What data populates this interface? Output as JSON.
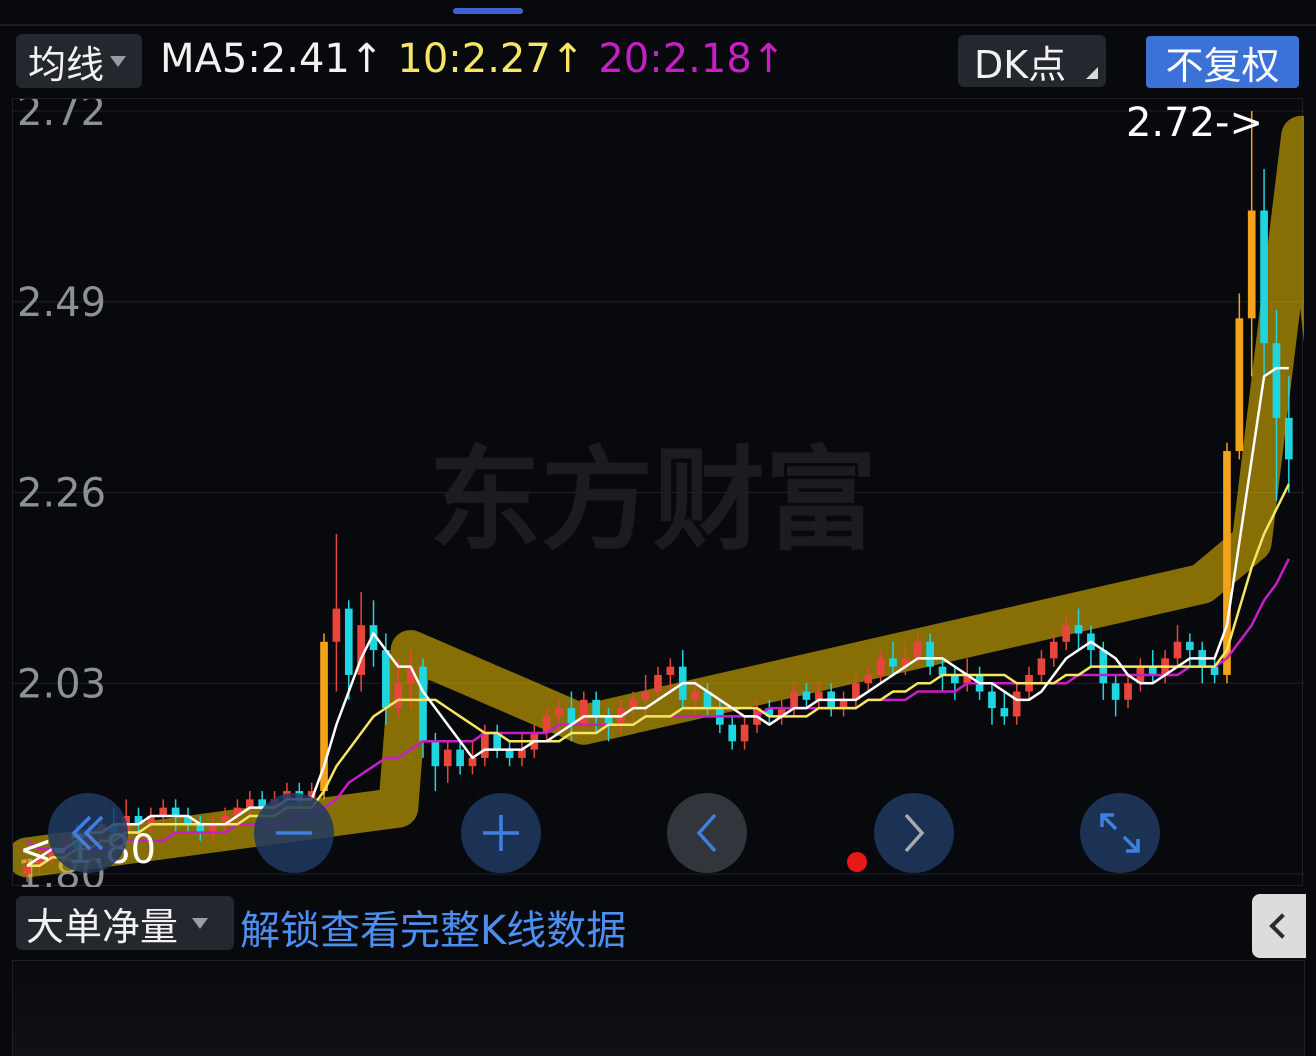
{
  "header": {
    "ma_dropdown_label": "均线",
    "ma5_text": "MA5:2.41↑",
    "ma10_text": "10:2.27↑",
    "ma20_text": "20:2.18↑",
    "dk_label": "DK点",
    "fq_label": "不复权"
  },
  "colors": {
    "up": "#e8453c",
    "down": "#1fd6e0",
    "ma5": "#ffffff",
    "ma10": "#f5e663",
    "ma20": "#c81ec8",
    "accent": "#3c72d8",
    "highlight": "#f2c300",
    "orange_bar": "#f5a21b"
  },
  "chart_data": {
    "type": "candlestick",
    "y_ticks": [
      "2.72",
      "2.49",
      "2.26",
      "2.03",
      "1.80"
    ],
    "ylim": [
      1.8,
      2.72
    ],
    "max_marker": "2.72->",
    "min_marker": "<-1.80",
    "watermark": "东方财富",
    "candles": [
      [
        1.8,
        1.81,
        1.79,
        1.82
      ],
      [
        1.81,
        1.82,
        1.8,
        1.83
      ],
      [
        1.82,
        1.83,
        1.81,
        1.84
      ],
      [
        1.83,
        1.84,
        1.82,
        1.85
      ],
      [
        1.84,
        1.83,
        1.82,
        1.86
      ],
      [
        1.83,
        1.85,
        1.82,
        1.86
      ],
      [
        1.85,
        1.86,
        1.84,
        1.87
      ],
      [
        1.86,
        1.85,
        1.84,
        1.88
      ],
      [
        1.85,
        1.87,
        1.84,
        1.89
      ],
      [
        1.87,
        1.86,
        1.85,
        1.88
      ],
      [
        1.86,
        1.87,
        1.85,
        1.88
      ],
      [
        1.87,
        1.88,
        1.86,
        1.89
      ],
      [
        1.88,
        1.87,
        1.85,
        1.89
      ],
      [
        1.87,
        1.86,
        1.85,
        1.88
      ],
      [
        1.86,
        1.85,
        1.84,
        1.87
      ],
      [
        1.85,
        1.86,
        1.84,
        1.87
      ],
      [
        1.86,
        1.87,
        1.85,
        1.88
      ],
      [
        1.87,
        1.88,
        1.86,
        1.89
      ],
      [
        1.88,
        1.89,
        1.87,
        1.9
      ],
      [
        1.89,
        1.88,
        1.87,
        1.9
      ],
      [
        1.88,
        1.89,
        1.87,
        1.9
      ],
      [
        1.89,
        1.9,
        1.88,
        1.91
      ],
      [
        1.9,
        1.89,
        1.88,
        1.91
      ],
      [
        1.89,
        1.9,
        1.88,
        1.91
      ],
      [
        1.9,
        2.08,
        1.89,
        2.09
      ],
      [
        2.08,
        2.12,
        2.02,
        2.21
      ],
      [
        2.12,
        2.04,
        2.01,
        2.13
      ],
      [
        2.04,
        2.1,
        2.02,
        2.14
      ],
      [
        2.1,
        2.07,
        2.05,
        2.13
      ],
      [
        2.07,
        2.0,
        1.98,
        2.09
      ],
      [
        2.0,
        2.03,
        1.99,
        2.06
      ],
      [
        2.03,
        2.05,
        2.0,
        2.07
      ],
      [
        2.05,
        1.96,
        1.94,
        2.06
      ],
      [
        1.96,
        1.93,
        1.9,
        1.97
      ],
      [
        1.93,
        1.95,
        1.91,
        1.96
      ],
      [
        1.95,
        1.93,
        1.92,
        1.96
      ],
      [
        1.93,
        1.94,
        1.92,
        1.96
      ],
      [
        1.94,
        1.97,
        1.93,
        1.98
      ],
      [
        1.97,
        1.95,
        1.94,
        1.98
      ],
      [
        1.95,
        1.94,
        1.93,
        1.96
      ],
      [
        1.94,
        1.95,
        1.93,
        1.97
      ],
      [
        1.95,
        1.97,
        1.94,
        1.98
      ],
      [
        1.97,
        1.99,
        1.96,
        2.0
      ],
      [
        1.99,
        2.0,
        1.97,
        2.01
      ],
      [
        2.0,
        1.98,
        1.96,
        2.02
      ],
      [
        1.98,
        2.01,
        1.97,
        2.02
      ],
      [
        2.01,
        1.99,
        1.97,
        2.02
      ],
      [
        1.99,
        1.98,
        1.96,
        2.0
      ],
      [
        1.98,
        2.0,
        1.97,
        2.01
      ],
      [
        2.0,
        2.01,
        1.98,
        2.02
      ],
      [
        2.01,
        2.02,
        1.99,
        2.04
      ],
      [
        2.02,
        2.04,
        2.01,
        2.05
      ],
      [
        2.04,
        2.05,
        2.02,
        2.06
      ],
      [
        2.05,
        2.01,
        2.0,
        2.07
      ],
      [
        2.01,
        2.02,
        1.99,
        2.03
      ],
      [
        2.02,
        2.0,
        1.99,
        2.03
      ],
      [
        2.0,
        1.98,
        1.97,
        2.01
      ],
      [
        1.98,
        1.96,
        1.95,
        1.99
      ],
      [
        1.96,
        1.98,
        1.95,
        1.99
      ],
      [
        1.98,
        2.0,
        1.97,
        2.01
      ],
      [
        2.0,
        1.99,
        1.98,
        2.01
      ],
      [
        1.99,
        2.0,
        1.98,
        2.01
      ],
      [
        2.0,
        2.02,
        1.99,
        2.03
      ],
      [
        2.02,
        2.01,
        2.0,
        2.03
      ],
      [
        2.01,
        2.02,
        2.0,
        2.03
      ],
      [
        2.02,
        2.0,
        1.99,
        2.03
      ],
      [
        2.0,
        2.01,
        1.99,
        2.02
      ],
      [
        2.01,
        2.03,
        2.0,
        2.04
      ],
      [
        2.03,
        2.04,
        2.02,
        2.05
      ],
      [
        2.04,
        2.06,
        2.03,
        2.07
      ],
      [
        2.06,
        2.05,
        2.04,
        2.08
      ],
      [
        2.05,
        2.06,
        2.04,
        2.08
      ],
      [
        2.06,
        2.08,
        2.05,
        2.09
      ],
      [
        2.08,
        2.05,
        2.04,
        2.09
      ],
      [
        2.05,
        2.04,
        2.02,
        2.06
      ],
      [
        2.04,
        2.03,
        2.01,
        2.05
      ],
      [
        2.03,
        2.04,
        2.02,
        2.06
      ],
      [
        2.04,
        2.02,
        2.01,
        2.05
      ],
      [
        2.02,
        2.0,
        1.98,
        2.03
      ],
      [
        2.0,
        1.99,
        1.98,
        2.02
      ],
      [
        1.99,
        2.02,
        1.98,
        2.03
      ],
      [
        2.02,
        2.04,
        2.01,
        2.05
      ],
      [
        2.04,
        2.06,
        2.03,
        2.07
      ],
      [
        2.06,
        2.08,
        2.05,
        2.09
      ],
      [
        2.08,
        2.1,
        2.07,
        2.11
      ],
      [
        2.1,
        2.09,
        2.07,
        2.12
      ],
      [
        2.09,
        2.07,
        2.05,
        2.1
      ],
      [
        2.07,
        2.03,
        2.01,
        2.08
      ],
      [
        2.03,
        2.01,
        1.99,
        2.04
      ],
      [
        2.01,
        2.03,
        2.0,
        2.04
      ],
      [
        2.03,
        2.05,
        2.02,
        2.06
      ],
      [
        2.05,
        2.04,
        2.03,
        2.07
      ],
      [
        2.04,
        2.06,
        2.03,
        2.07
      ],
      [
        2.06,
        2.08,
        2.05,
        2.1
      ],
      [
        2.08,
        2.07,
        2.05,
        2.09
      ],
      [
        2.07,
        2.05,
        2.03,
        2.08
      ],
      [
        2.05,
        2.04,
        2.03,
        2.06
      ],
      [
        2.04,
        2.31,
        2.03,
        2.32
      ],
      [
        2.31,
        2.47,
        2.3,
        2.5
      ],
      [
        2.47,
        2.6,
        2.4,
        2.72
      ],
      [
        2.6,
        2.44,
        2.4,
        2.65
      ],
      [
        2.44,
        2.35,
        2.25,
        2.48
      ],
      [
        2.35,
        2.3,
        2.26,
        2.4
      ]
    ],
    "ma5": [
      1.81,
      1.82,
      1.83,
      1.83,
      1.84,
      1.85,
      1.85,
      1.86,
      1.86,
      1.86,
      1.87,
      1.87,
      1.87,
      1.87,
      1.86,
      1.86,
      1.86,
      1.87,
      1.88,
      1.88,
      1.88,
      1.89,
      1.89,
      1.89,
      1.93,
      1.98,
      2.02,
      2.06,
      2.09,
      2.07,
      2.05,
      2.05,
      2.02,
      2.0,
      1.98,
      1.96,
      1.94,
      1.95,
      1.95,
      1.95,
      1.95,
      1.96,
      1.96,
      1.97,
      1.98,
      1.99,
      1.99,
      1.99,
      1.99,
      2.0,
      2.0,
      2.01,
      2.02,
      2.03,
      2.03,
      2.02,
      2.01,
      2.0,
      1.99,
      1.99,
      1.98,
      1.99,
      2.0,
      2.0,
      2.01,
      2.01,
      2.01,
      2.01,
      2.02,
      2.03,
      2.04,
      2.05,
      2.06,
      2.06,
      2.06,
      2.05,
      2.04,
      2.03,
      2.03,
      2.02,
      2.01,
      2.01,
      2.02,
      2.04,
      2.06,
      2.07,
      2.08,
      2.07,
      2.06,
      2.04,
      2.03,
      2.03,
      2.04,
      2.05,
      2.06,
      2.06,
      2.06,
      2.1,
      2.2,
      2.3,
      2.4,
      2.41,
      2.41
    ],
    "ma10": [
      1.81,
      1.81,
      1.82,
      1.82,
      1.83,
      1.83,
      1.84,
      1.84,
      1.85,
      1.85,
      1.86,
      1.86,
      1.86,
      1.86,
      1.86,
      1.86,
      1.86,
      1.86,
      1.87,
      1.87,
      1.87,
      1.88,
      1.88,
      1.88,
      1.9,
      1.93,
      1.95,
      1.97,
      1.99,
      2.0,
      2.01,
      2.01,
      2.01,
      2.01,
      2.0,
      1.99,
      1.98,
      1.97,
      1.97,
      1.96,
      1.96,
      1.96,
      1.96,
      1.96,
      1.97,
      1.97,
      1.97,
      1.98,
      1.98,
      1.98,
      1.99,
      1.99,
      1.99,
      2.0,
      2.0,
      2.0,
      2.0,
      2.0,
      2.0,
      2.0,
      1.99,
      1.99,
      1.99,
      1.99,
      2.0,
      2.0,
      2.0,
      2.0,
      2.01,
      2.01,
      2.02,
      2.02,
      2.03,
      2.03,
      2.04,
      2.04,
      2.04,
      2.04,
      2.04,
      2.04,
      2.03,
      2.03,
      2.03,
      2.03,
      2.04,
      2.04,
      2.05,
      2.05,
      2.05,
      2.05,
      2.05,
      2.05,
      2.05,
      2.05,
      2.05,
      2.05,
      2.05,
      2.07,
      2.12,
      2.17,
      2.21,
      2.24,
      2.27
    ],
    "ma20": [
      1.84,
      1.83,
      1.83,
      1.83,
      1.83,
      1.83,
      1.83,
      1.83,
      1.84,
      1.84,
      1.84,
      1.84,
      1.85,
      1.85,
      1.85,
      1.85,
      1.85,
      1.86,
      1.86,
      1.86,
      1.86,
      1.86,
      1.87,
      1.87,
      1.88,
      1.89,
      1.91,
      1.92,
      1.93,
      1.94,
      1.94,
      1.95,
      1.96,
      1.96,
      1.96,
      1.96,
      1.96,
      1.97,
      1.97,
      1.97,
      1.97,
      1.97,
      1.97,
      1.98,
      1.98,
      1.98,
      1.98,
      1.98,
      1.98,
      1.98,
      1.99,
      1.99,
      1.99,
      1.99,
      1.99,
      1.99,
      1.99,
      1.99,
      1.99,
      1.99,
      2.0,
      2.0,
      2.0,
      2.0,
      2.0,
      2.0,
      2.0,
      2.0,
      2.01,
      2.01,
      2.01,
      2.01,
      2.02,
      2.02,
      2.02,
      2.02,
      2.03,
      2.03,
      2.03,
      2.03,
      2.03,
      2.03,
      2.03,
      2.03,
      2.03,
      2.04,
      2.04,
      2.04,
      2.04,
      2.04,
      2.04,
      2.04,
      2.04,
      2.04,
      2.05,
      2.05,
      2.05,
      2.06,
      2.08,
      2.1,
      2.13,
      2.15,
      2.18
    ],
    "trend_highlight": [
      {
        "x": 0,
        "y": 1.82
      },
      {
        "x": 30,
        "y": 1.88
      },
      {
        "x": 31,
        "y": 2.07
      },
      {
        "x": 45,
        "y": 1.98
      },
      {
        "x": 95,
        "y": 2.15
      },
      {
        "x": 99,
        "y": 2.2
      },
      {
        "x": 103,
        "y": 2.69
      },
      {
        "x": 108,
        "y": 2.02
      }
    ],
    "nav_buttons": [
      "double-left",
      "zoom-out",
      "zoom-in",
      "prev",
      "next",
      "expand"
    ]
  },
  "bottom": {
    "indicator_label": "大单净量",
    "unlock_text": "解锁查看完整K线数据"
  }
}
